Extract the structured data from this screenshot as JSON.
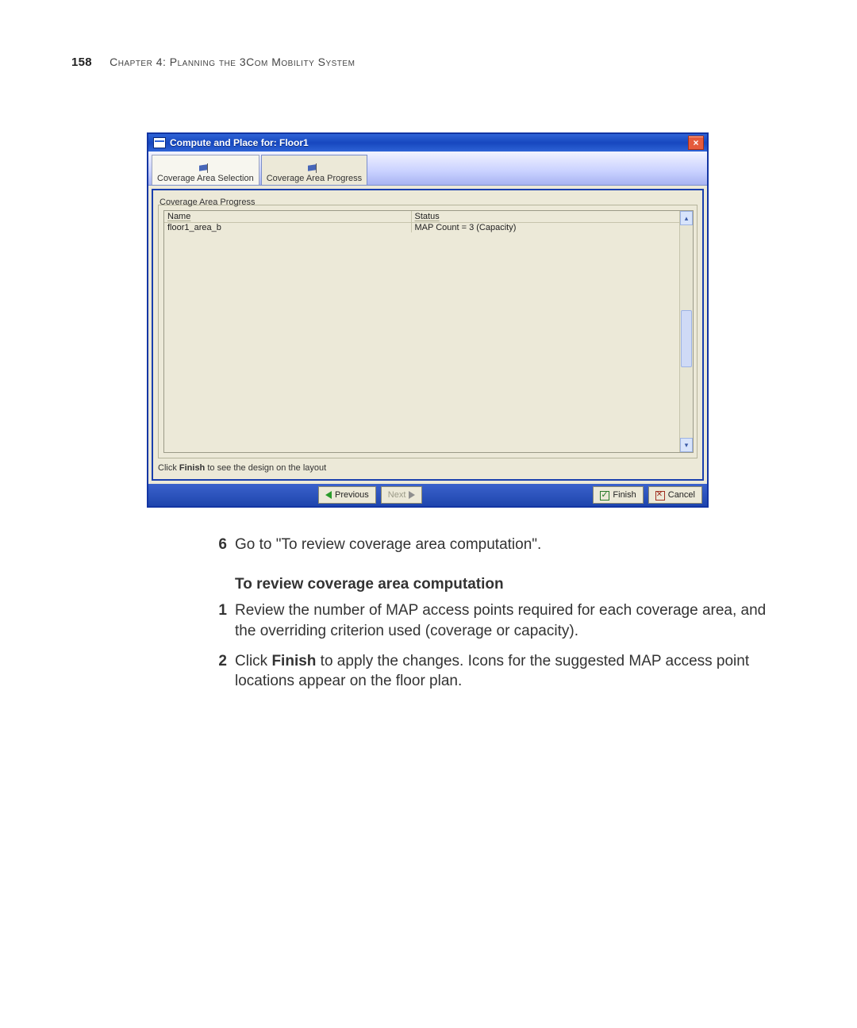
{
  "header": {
    "page_number": "158",
    "chapter_label": "Chapter 4: Planning the 3Com Mobility System"
  },
  "dialog": {
    "title": "Compute and Place for: Floor1",
    "tabs": [
      {
        "label": "Coverage Area Selection",
        "active": false
      },
      {
        "label": "Coverage Area Progress",
        "active": true
      }
    ],
    "group_label": "Coverage Area Progress",
    "columns": {
      "name": "Name",
      "status": "Status"
    },
    "rows": [
      {
        "name": "floor1_area_b",
        "status": "MAP Count = 3 (Capacity)"
      }
    ],
    "hint_prefix": "Click ",
    "hint_bold": "Finish",
    "hint_suffix": " to see the design on the layout",
    "buttons": {
      "previous": "Previous",
      "next": "Next",
      "finish": "Finish",
      "cancel": "Cancel"
    }
  },
  "body": {
    "step6": "Go to \"To review coverage area computation\".",
    "heading": "To review coverage area computation",
    "step1": "Review the number of MAP access points required for each coverage area, and the overriding criterion used (coverage or capacity).",
    "step2a": "Click ",
    "step2b": "Finish",
    "step2c": " to apply the changes. Icons for the suggested MAP access point locations appear on the floor plan."
  }
}
